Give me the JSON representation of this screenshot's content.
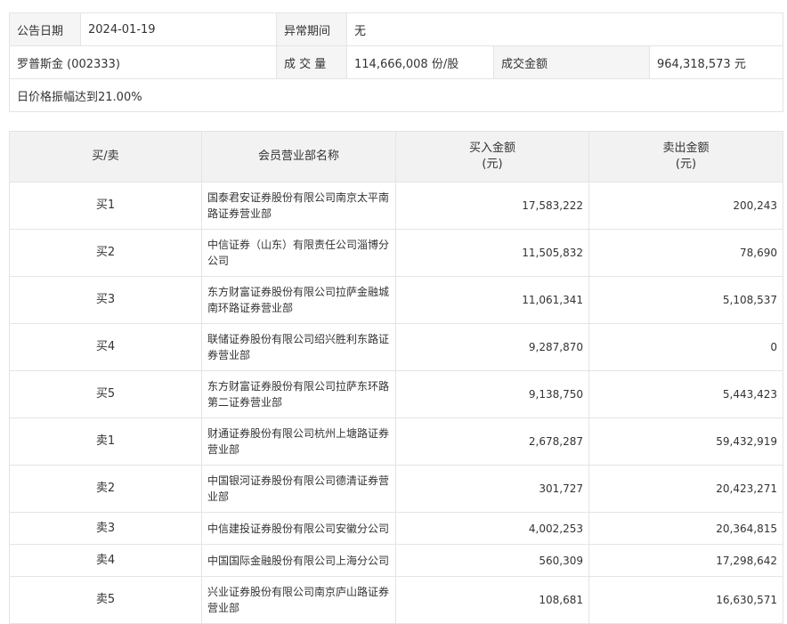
{
  "summary": {
    "date_label": "公告日期",
    "date_value": "2024-01-19",
    "abnormal_label": "异常期间",
    "abnormal_value": "无",
    "stock": "罗普斯金 (002333)",
    "volume_label": "成 交 量",
    "volume_value": "114,666,008 份/股",
    "amount_label": "成交金额",
    "amount_value": "964,318,573 元",
    "reason": "日价格振幅达到21.00%"
  },
  "table": {
    "headers": {
      "side": "买/卖",
      "name": "会员营业部名称",
      "buy_line1": "买入金额",
      "buy_line2": "(元)",
      "sell_line1": "卖出金额",
      "sell_line2": "(元)"
    },
    "rows": [
      {
        "side": "买1",
        "name": "国泰君安证券股份有限公司南京太平南路证券营业部",
        "buy": "17,583,222",
        "sell": "200,243"
      },
      {
        "side": "买2",
        "name": "中信证券（山东）有限责任公司淄博分公司",
        "buy": "11,505,832",
        "sell": "78,690"
      },
      {
        "side": "买3",
        "name": "东方财富证券股份有限公司拉萨金融城南环路证券营业部",
        "buy": "11,061,341",
        "sell": "5,108,537"
      },
      {
        "side": "买4",
        "name": "联储证券股份有限公司绍兴胜利东路证券营业部",
        "buy": "9,287,870",
        "sell": "0"
      },
      {
        "side": "买5",
        "name": "东方财富证券股份有限公司拉萨东环路第二证券营业部",
        "buy": "9,138,750",
        "sell": "5,443,423"
      },
      {
        "side": "卖1",
        "name": "财通证券股份有限公司杭州上塘路证券营业部",
        "buy": "2,678,287",
        "sell": "59,432,919"
      },
      {
        "side": "卖2",
        "name": "中国银河证券股份有限公司德清证券营业部",
        "buy": "301,727",
        "sell": "20,423,271"
      },
      {
        "side": "卖3",
        "name": "中信建投证券股份有限公司安徽分公司",
        "buy": "4,002,253",
        "sell": "20,364,815"
      },
      {
        "side": "卖4",
        "name": "中国国际金融股份有限公司上海分公司",
        "buy": "560,309",
        "sell": "17,298,642"
      },
      {
        "side": "卖5",
        "name": "兴业证券股份有限公司南京庐山路证券营业部",
        "buy": "108,681",
        "sell": "16,630,571"
      }
    ]
  }
}
